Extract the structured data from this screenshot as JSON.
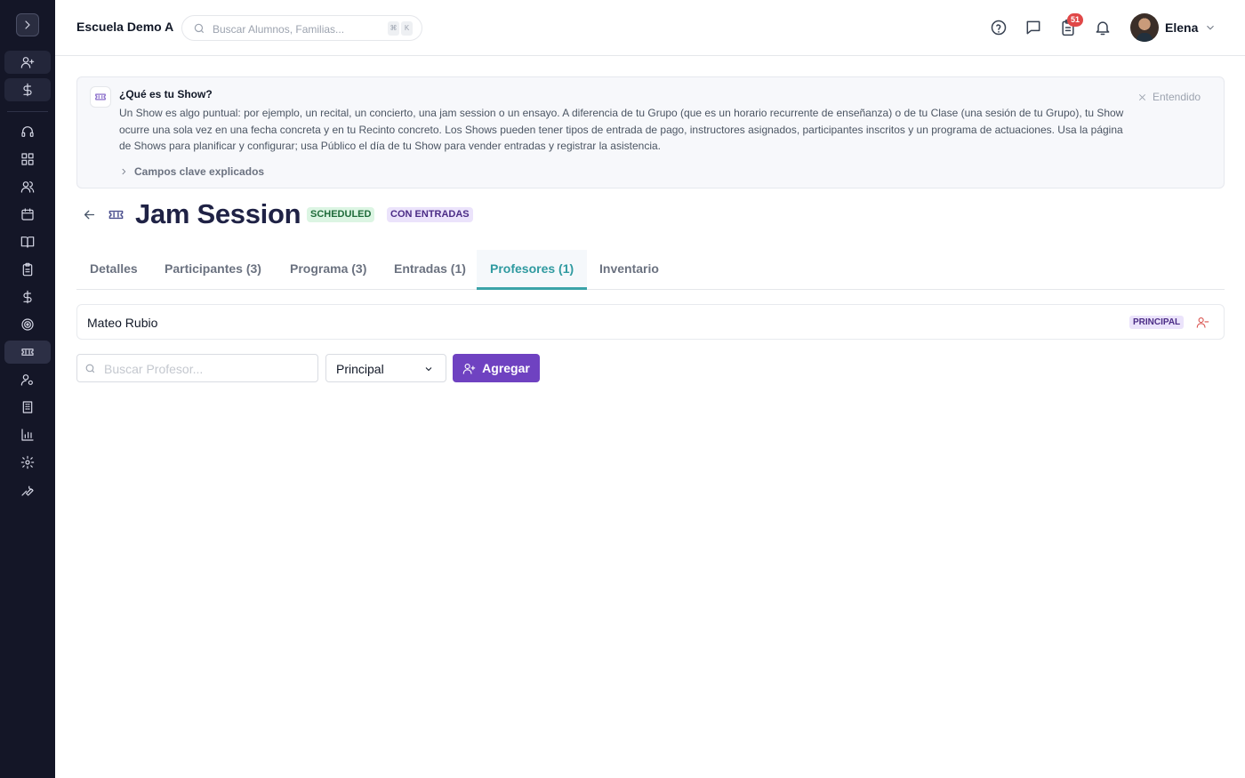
{
  "topbar": {
    "school_name": "Escuela Demo A",
    "search_placeholder": "Buscar Alumnos, Familias...",
    "shortcut_keys": [
      "⌘",
      "K"
    ],
    "notification_count": "51",
    "user_name": "Elena"
  },
  "sidebar": {
    "items": [
      "add-user-icon",
      "dollar-icon",
      "headset-icon",
      "dashboard-icon",
      "users-icon",
      "calendar-icon",
      "book-icon",
      "clipboard-icon",
      "dollar-icon",
      "target-icon",
      "ticket-icon",
      "user-settings-icon",
      "building-icon",
      "chart-icon",
      "gear-icon",
      "wrench-icon"
    ],
    "active_item": "ticket-icon"
  },
  "banner": {
    "title": "¿Qué es tu Show?",
    "text": "Un Show es algo puntual: por ejemplo, un recital, un concierto, una jam session o un ensayo. A diferencia de tu Grupo (que es un horario recurrente de enseñanza) o de tu Clase (una sesión de tu Grupo), tu Show ocurre una sola vez en una fecha concreta y en tu Recinto concreto. Los Shows pueden tener tipos de entrada de pago, instructores asignados, participantes inscritos y un programa de actuaciones. Usa la página de Shows para planificar y configurar; usa Público el día de tu Show para vender entradas y registrar la asistencia.",
    "dismiss_label": "Entendido",
    "expand_label": "Campos clave explicados"
  },
  "page": {
    "title": "Jam Session",
    "status_badge": "SCHEDULED",
    "tickets_badge": "CON ENTRADAS"
  },
  "tabs": [
    {
      "label": "Detalles"
    },
    {
      "label": "Participantes (3)"
    },
    {
      "label": "Programa (3)"
    },
    {
      "label": "Entradas (1)"
    },
    {
      "label": "Profesores (1)"
    },
    {
      "label": "Inventario"
    }
  ],
  "active_tab": "Profesores (1)",
  "teachers": [
    {
      "name": "Mateo Rubio",
      "role": "PRINCIPAL"
    }
  ],
  "add_form": {
    "search_placeholder": "Buscar Profesor...",
    "role_value": "Principal",
    "add_label": "Agregar"
  },
  "colors": {
    "sidebar_bg": "#141627",
    "accent_purple": "#6f42c1",
    "active_tab": "#2f9aa0",
    "badge_red": "#e04848"
  }
}
